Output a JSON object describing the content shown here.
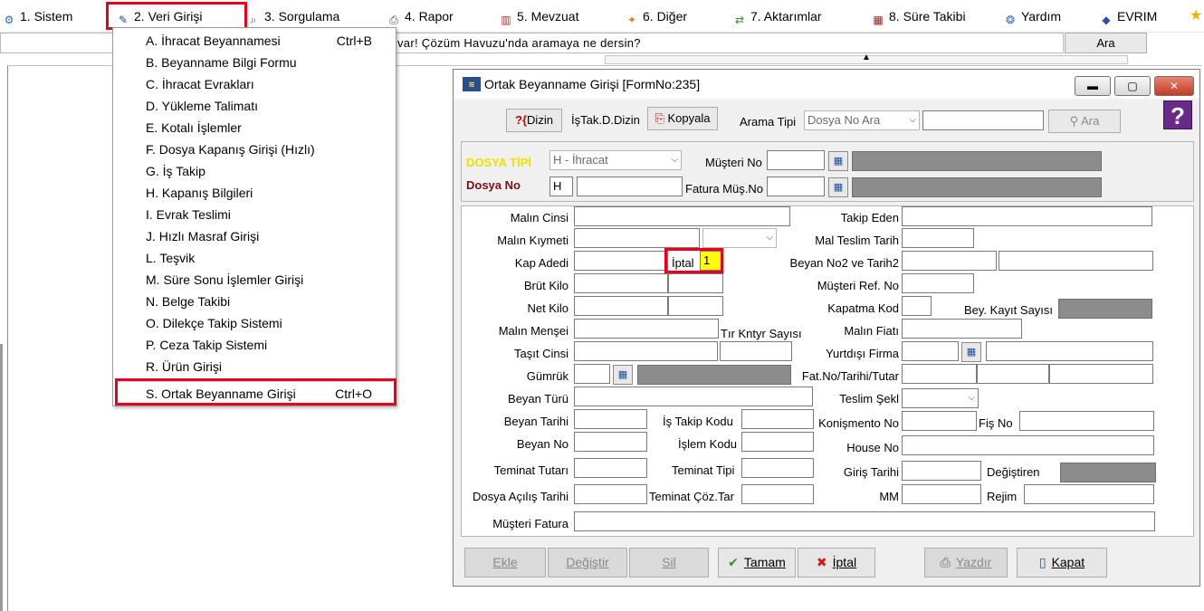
{
  "menubar": {
    "items": [
      {
        "label": "1.  Sistem",
        "icon": "system-icon"
      },
      {
        "label": "2.  Veri Girişi",
        "icon": "data-entry-icon"
      },
      {
        "label": "3.  Sorgulama",
        "icon": "query-icon"
      },
      {
        "label": "4.  Rapor",
        "icon": "printer-icon"
      },
      {
        "label": "5.  Mevzuat",
        "icon": "books-icon"
      },
      {
        "label": "6.  Diğer",
        "icon": "other-icon"
      },
      {
        "label": "7.  Aktarımlar",
        "icon": "transfer-icon"
      },
      {
        "label": "8. Süre Takibi",
        "icon": "calendar-icon"
      },
      {
        "label": "Yardım",
        "icon": "help-icon"
      },
      {
        "label": "EVRIM",
        "icon": "evrim-icon"
      }
    ]
  },
  "search": {
    "text": "var! Çözüm Havuzu'nda aramaya ne dersin?",
    "button": "Ara"
  },
  "dropdown": {
    "items": [
      {
        "label": "A.  İhracat Beyannamesi",
        "shortcut": "Ctrl+B"
      },
      {
        "label": "B.  Beyanname Bilgi Formu",
        "shortcut": ""
      },
      {
        "label": "C.  İhracat Evrakları",
        "shortcut": ""
      },
      {
        "label": "D.  Yükleme Talimatı",
        "shortcut": ""
      },
      {
        "label": "E.  Kotalı İşlemler",
        "shortcut": ""
      },
      {
        "label": "F.  Dosya Kapanış Girişi (Hızlı)",
        "shortcut": ""
      },
      {
        "label": "G.  İş Takip",
        "shortcut": ""
      },
      {
        "label": "H.  Kapanış Bilgileri",
        "shortcut": ""
      },
      {
        "label": "I.  Evrak Teslimi",
        "shortcut": ""
      },
      {
        "label": "J.  Hızlı Masraf Girişi",
        "shortcut": ""
      },
      {
        "label": "L.  Teşvik",
        "shortcut": ""
      },
      {
        "label": "M.  Süre Sonu İşlemler Girişi",
        "shortcut": ""
      },
      {
        "label": "N.  Belge Takibi",
        "shortcut": ""
      },
      {
        "label": "O.  Dilekçe Takip Sistemi",
        "shortcut": ""
      },
      {
        "label": "P.  Ceza Takip Sistemi",
        "shortcut": ""
      },
      {
        "label": "R.  Ürün Girişi",
        "shortcut": ""
      }
    ],
    "last": {
      "label": "S.  Ortak Beyanname Girişi",
      "shortcut": "Ctrl+O"
    }
  },
  "dialog": {
    "title": "Ortak Beyanname Girişi [FormNo:235]",
    "toolbar": {
      "dizin": "Dizin",
      "istak_dizin": "İşTak.D.Dizin",
      "kopyala": "Kopyala",
      "arama_tipi_label": "Arama Tipi",
      "arama_tipi_value": "Dosya No Ara",
      "ara_button": "Ara",
      "help": "?"
    },
    "header": {
      "dosya_tipi_label": "DOSYA TİPİ",
      "dosya_tipi_value": "H - İhracat",
      "dosya_no_label": "Dosya No",
      "dosya_no_prefix": "H",
      "musteri_no_label": "Müşteri No",
      "fatura_mus_no_label": "Fatura Müş.No"
    },
    "left_labels": {
      "malin_cinsi": "Malın Cinsi",
      "malin_kiymeti": "Malın Kıymeti",
      "kap_adedi": "Kap Adedi",
      "iptal": "İptal",
      "iptal_value": "1",
      "brut_kilo": "Brüt Kilo",
      "net_kilo": "Net Kilo",
      "malin_mensei": "Malın Menşei",
      "tir_kntyr": "Tır Kntyr Sayısı",
      "tasit_cinsi": "Taşıt Cinsi",
      "gumruk": "Gümrük",
      "beyan_turu": "Beyan Türü",
      "beyan_tarihi": "Beyan Tarihi",
      "is_takip_kodu": "İş Takip Kodu",
      "beyan_no": "Beyan No",
      "islem_kodu": "İşlem Kodu",
      "teminat_tutari": "Teminat Tutarı",
      "teminat_tipi": "Teminat Tipi",
      "dosya_acilis": "Dosya Açılış Tarihi",
      "teminat_coz": "Teminat Çöz.Tar",
      "musteri_fatura": "Müşteri Fatura"
    },
    "right_labels": {
      "takip_eden": "Takip Eden",
      "mal_teslim_tarih": "Mal Teslim Tarih",
      "beyan_no2": "Beyan  No2 ve Tarih2",
      "musteri_ref_no": "Müşteri  Ref. No",
      "kapatma_kod": "Kapatma Kod",
      "bey_kayit": "Bey. Kayıt Sayısı",
      "malin_fiati": "Malın Fiatı",
      "yurtdisi_firma": "Yurtdışı Firma",
      "fat_no": "Fat.No/Tarihi/Tutar",
      "teslim_sekl": "Teslim Şekl",
      "konismento_no": "Konişmento No",
      "fis_no": "Fiş No",
      "house_no": "House No",
      "giris_tarihi": "Giriş Tarihi",
      "degistiren": "Değiştiren",
      "mm": "MM",
      "rejim": "Rejim"
    },
    "buttons": {
      "ekle": "Ekle",
      "degistir": "Değiştir",
      "sil": "Sil",
      "tamam": "Tamam",
      "iptal": "İptal",
      "yazdir": "Yazdır",
      "kapat": "Kapat"
    }
  }
}
